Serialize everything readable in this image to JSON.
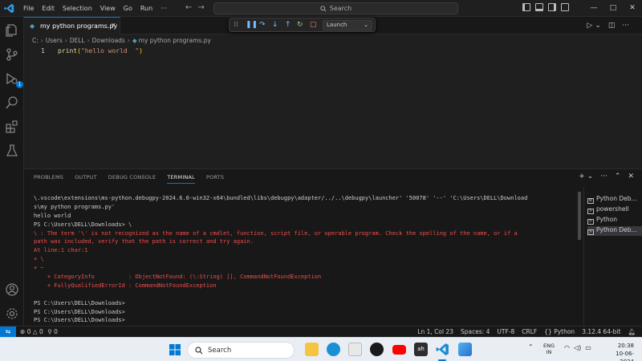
{
  "titlebar": {
    "menus": [
      "File",
      "Edit",
      "Selection",
      "View",
      "Go",
      "Run",
      "···"
    ],
    "search_placeholder": "Search",
    "controls": [
      "—",
      "□",
      "✕"
    ]
  },
  "debug_toolbar": {
    "launch_config": "Launch"
  },
  "tab": {
    "label": "my python programs.py",
    "close": "✕"
  },
  "breadcrumb": {
    "parts": [
      "C:",
      "Users",
      "DELL",
      "Downloads"
    ],
    "file": "my python programs.py"
  },
  "editor": {
    "line_number": "1",
    "fn": "print",
    "open_paren": "(",
    "string": "\"hello world  \"",
    "close_paren": ")"
  },
  "panel": {
    "tabs": [
      "PROBLEMS",
      "OUTPUT",
      "DEBUG CONSOLE",
      "TERMINAL",
      "PORTS"
    ],
    "active_tab": "TERMINAL"
  },
  "terminal": {
    "lines": [
      {
        "text": "\\.vscode\\extensions\\ms-python.debugpy-2024.6.0-win32-x64\\bundled\\libs\\debugpy\\adapter/../..\\debugpy\\launcher' '50078' '--' 'C:\\Users\\DELL\\Download",
        "color": "white"
      },
      {
        "text": "s\\my python programs.py'",
        "color": "white"
      },
      {
        "text": "hello world",
        "color": "white"
      },
      {
        "text": "PS C:\\Users\\DELL\\Downloads> \\",
        "color": "white"
      },
      {
        "text": "\\ : The term '\\' is not recognized as the name of a cmdlet, function, script file, or operable program. Check the spelling of the name, or if a",
        "color": "red"
      },
      {
        "text": "path was included, verify that the path is correct and try again.",
        "color": "red"
      },
      {
        "text": "At line:1 char:1",
        "color": "red"
      },
      {
        "text": "+ \\",
        "color": "red"
      },
      {
        "text": "+ ~",
        "color": "red"
      },
      {
        "text": "    + CategoryInfo          : ObjectNotFound: (\\:String) [], CommandNotFoundException",
        "color": "red"
      },
      {
        "text": "    + FullyQualifiedErrorId : CommandNotFoundException",
        "color": "red"
      },
      {
        "text": "",
        "color": "white"
      },
      {
        "text": "PS C:\\Users\\DELL\\Downloads>",
        "color": "white"
      },
      {
        "text": "PS C:\\Users\\DELL\\Downloads>",
        "color": "white"
      },
      {
        "text": "PS C:\\Users\\DELL\\Downloads>",
        "color": "white"
      }
    ]
  },
  "terminal_list": [
    {
      "label": "Python Deb...",
      "type": "debug"
    },
    {
      "label": "powershell",
      "type": "shell"
    },
    {
      "label": "Python",
      "type": "shell"
    },
    {
      "label": "Python Deb...",
      "type": "shell"
    }
  ],
  "statusbar": {
    "errors": "0",
    "warnings": "0",
    "ports": "0",
    "position": "Ln 1, Col 23",
    "spaces": "Spaces: 4",
    "encoding": "UTF-8",
    "eol": "CRLF",
    "language": "Python",
    "interpreter": "3.12.4 64-bit"
  },
  "taskbar": {
    "search": "Search",
    "lang_top": "ENG",
    "lang_bottom": "IN",
    "time": "20:38",
    "date": "10-06-2024"
  },
  "colors": {
    "accent": "#0078d4",
    "error": "#f14c4c",
    "string": "#ce9178",
    "function": "#dcdcaa"
  }
}
